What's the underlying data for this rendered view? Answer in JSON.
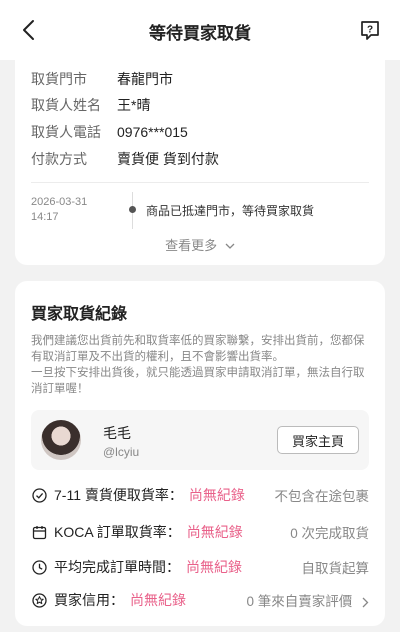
{
  "header": {
    "title": "等待買家取貨"
  },
  "pickup": {
    "rows": [
      {
        "label": "取貨門市",
        "value": "春龍門市"
      },
      {
        "label": "取貨人姓名",
        "value": "王*晴"
      },
      {
        "label": "取貨人電話",
        "value": "0976***015"
      },
      {
        "label": "付款方式",
        "value": "賣貨便 貨到付款"
      }
    ],
    "timeline": {
      "date": "2026-03-31",
      "time": "14:17",
      "text": "商品已抵達門市，等待買家取貨"
    },
    "more_label": "查看更多"
  },
  "buyer_record": {
    "title": "買家取貨紀錄",
    "description": "我們建議您出貨前先和取貨率低的買家聯繫，安排出貨前，您都保有取消訂單及不出貨的權利，且不會影響出貨率。\n一旦按下安排出貨後，就只能透過買家申請取消訂單，無法自行取消訂單喔！",
    "buyer": {
      "name": "毛毛",
      "id": "@lcyiu",
      "button_label": "買家主頁"
    },
    "stats": [
      {
        "icon": "check-circle-icon",
        "label": "7-11 賣貨便取貨率：",
        "value": "尚無紀錄",
        "note": "不包含在途包裹"
      },
      {
        "icon": "calendar-icon",
        "label": "KOCA 訂單取貨率：",
        "value": "尚無紀錄",
        "note": "0 次完成取貨"
      },
      {
        "icon": "clock-icon",
        "label": "平均完成訂單時間：",
        "value": "尚無紀錄",
        "note": "自取貨起算"
      },
      {
        "icon": "star-badge-icon",
        "label": "買家信用：",
        "value": "尚無紀錄",
        "note": "0 筆來自賣家評價"
      }
    ]
  },
  "colors": {
    "accent": "#e9618a",
    "muted": "#888888"
  }
}
